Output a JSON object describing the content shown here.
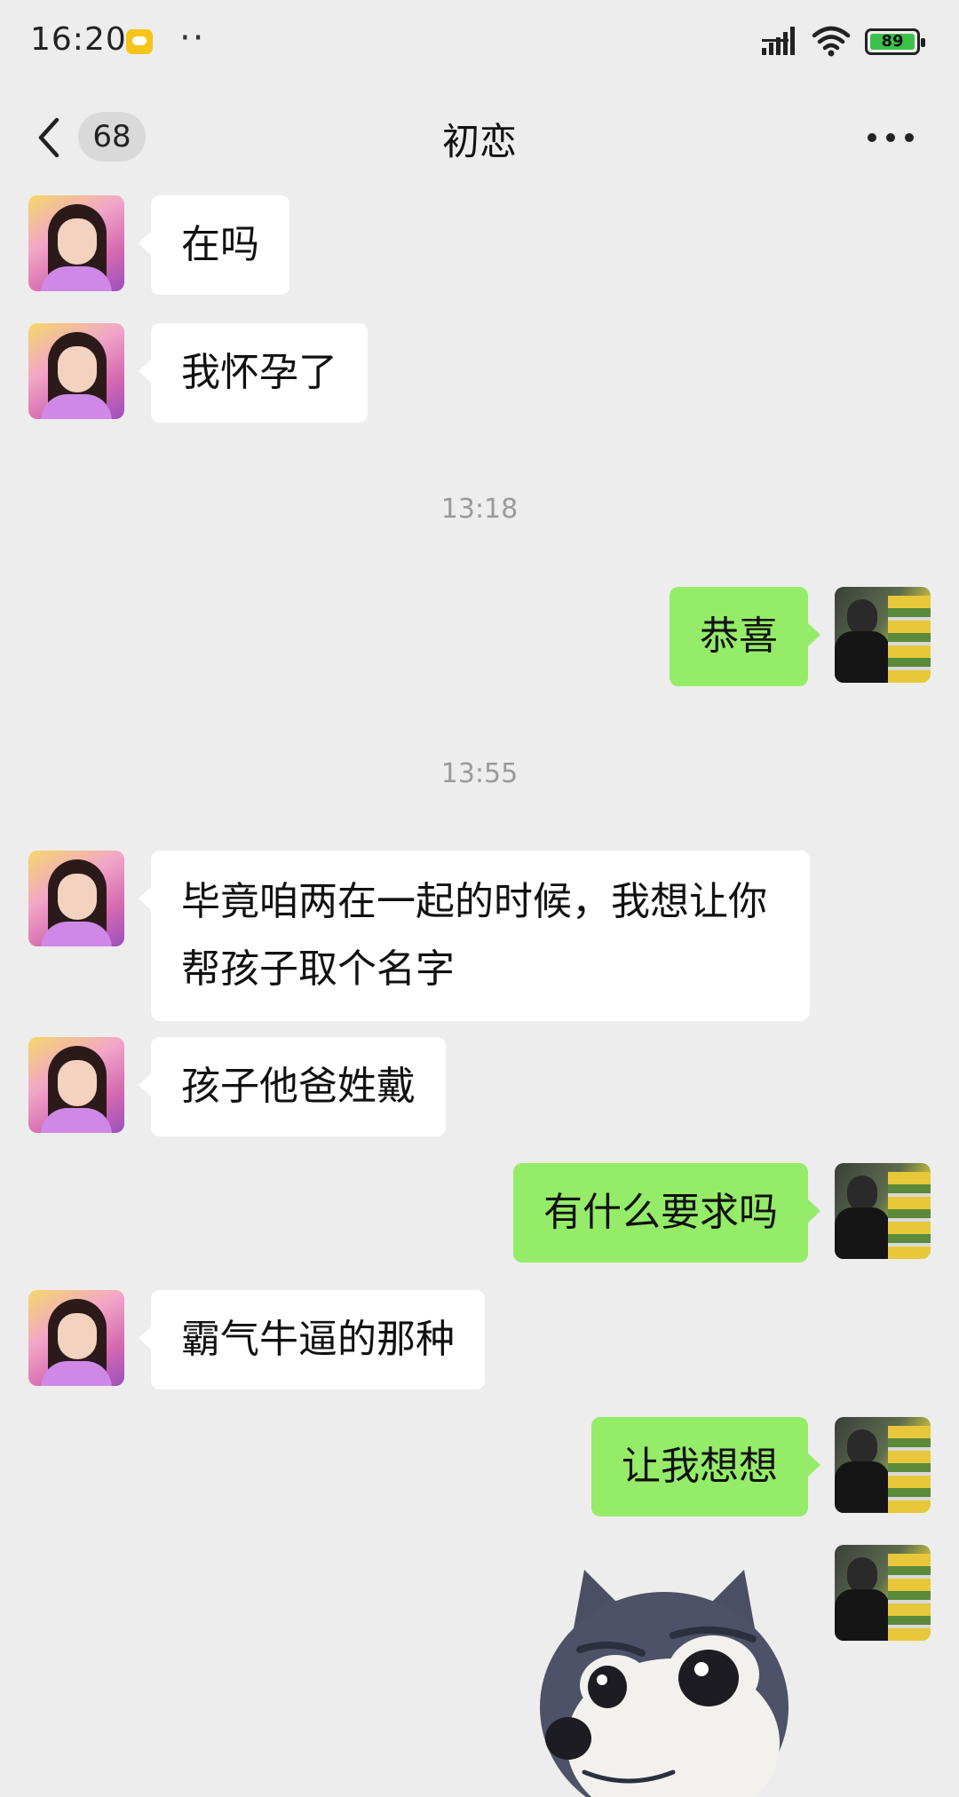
{
  "status_bar": {
    "time": "16:20",
    "battery_level": "89",
    "icons": [
      "message-notification-icon",
      "more-notifications-icon",
      "signal-icon",
      "wifi-icon",
      "battery-icon"
    ]
  },
  "nav": {
    "unread_count": "68",
    "title": "初恋",
    "back_icon": "chevron-left-icon",
    "more_icon": "more-horizontal-icon"
  },
  "messages": [
    {
      "from": "her",
      "text": "在吗"
    },
    {
      "from": "her",
      "text": "我怀孕了"
    },
    {
      "type": "time",
      "text": "13:18"
    },
    {
      "from": "me",
      "text": "恭喜"
    },
    {
      "type": "time",
      "text": "13:55"
    },
    {
      "from": "her",
      "text": "毕竟咱两在一起的时候，我想让你帮孩子取个名字"
    },
    {
      "from": "her",
      "text": "孩子他爸姓戴"
    },
    {
      "from": "me",
      "text": "有什么要求吗"
    },
    {
      "from": "her",
      "text": "霸气牛逼的那种"
    },
    {
      "from": "me",
      "text": "让我想想"
    },
    {
      "from": "me",
      "type": "sticker",
      "sticker": "dog-face-sticker"
    }
  ],
  "colors": {
    "background": "#ededed",
    "bubble_incoming": "#ffffff",
    "bubble_outgoing": "#95ec69",
    "battery_fill": "#3cc24a",
    "notification": "#f5c518"
  }
}
